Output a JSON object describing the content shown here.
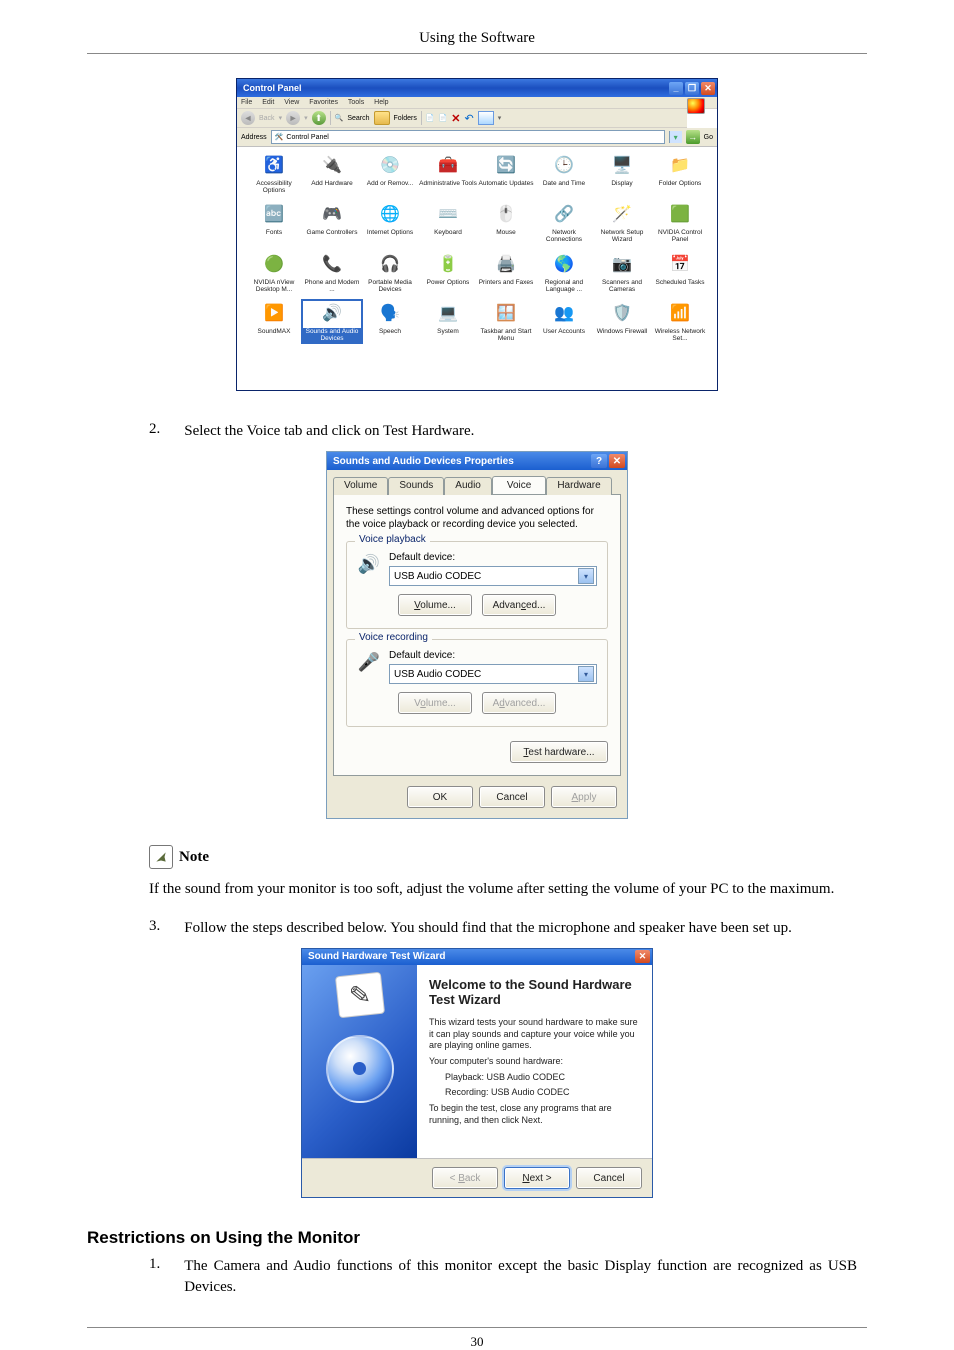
{
  "page_header": "Using the Software",
  "page_number": "30",
  "numbered_items": {
    "2": {
      "num": "2.",
      "text": "Select the Voice tab and click on Test Hardware."
    },
    "3": {
      "num": "3.",
      "text": "Follow the steps described below. You should find that the microphone and speaker have been set up."
    }
  },
  "note": {
    "label": "Note",
    "text": "If the sound from your monitor is too soft, adjust the volume after setting the volume of your PC to the maximum."
  },
  "section_h2": "Restrictions on Using the Monitor",
  "sec_item1": {
    "num": "1.",
    "text": "The Camera and Audio functions of this monitor except the basic Display function are recognized as USB Devices."
  },
  "cp": {
    "title": "Control Panel",
    "menus": {
      "file": "File",
      "edit": "Edit",
      "view": "View",
      "fav": "Favorites",
      "tools": "Tools",
      "help": "Help"
    },
    "toolbar": {
      "back": "Back",
      "search": "Search",
      "folders": "Folders"
    },
    "address": {
      "label": "Address",
      "value": "Control Panel",
      "go": "Go"
    },
    "buttons": {
      "min": "_",
      "max": "❐",
      "close": "✕"
    },
    "items": [
      {
        "label": "Accessibility Options",
        "icon": "♿"
      },
      {
        "label": "Add Hardware",
        "icon": "🔌"
      },
      {
        "label": "Add or Remov...",
        "icon": "💿"
      },
      {
        "label": "Administrative Tools",
        "icon": "🧰"
      },
      {
        "label": "Automatic Updates",
        "icon": "🔄"
      },
      {
        "label": "Date and Time",
        "icon": "🕒"
      },
      {
        "label": "Display",
        "icon": "🖥️"
      },
      {
        "label": "Folder Options",
        "icon": "📁"
      },
      {
        "label": "Fonts",
        "icon": "🔤"
      },
      {
        "label": "Game Controllers",
        "icon": "🎮"
      },
      {
        "label": "Internet Options",
        "icon": "🌐"
      },
      {
        "label": "Keyboard",
        "icon": "⌨️"
      },
      {
        "label": "Mouse",
        "icon": "🖱️"
      },
      {
        "label": "Network Connections",
        "icon": "🔗"
      },
      {
        "label": "Network Setup Wizard",
        "icon": "🪄"
      },
      {
        "label": "NVIDIA Control Panel",
        "icon": "🟩"
      },
      {
        "label": "NVIDIA nView Desktop M...",
        "icon": "🟢"
      },
      {
        "label": "Phone and Modem ...",
        "icon": "📞"
      },
      {
        "label": "Portable Media Devices",
        "icon": "🎧"
      },
      {
        "label": "Power Options",
        "icon": "🔋"
      },
      {
        "label": "Printers and Faxes",
        "icon": "🖨️"
      },
      {
        "label": "Regional and Language ...",
        "icon": "🌎"
      },
      {
        "label": "Scanners and Cameras",
        "icon": "📷"
      },
      {
        "label": "Scheduled Tasks",
        "icon": "📅"
      },
      {
        "label": "SoundMAX",
        "icon": "▶️"
      },
      {
        "label": "Sounds and Audio Devices",
        "icon": "🔊",
        "selected": true
      },
      {
        "label": "Speech",
        "icon": "🗣️"
      },
      {
        "label": "System",
        "icon": "💻"
      },
      {
        "label": "Taskbar and Start Menu",
        "icon": "🪟"
      },
      {
        "label": "User Accounts",
        "icon": "👥"
      },
      {
        "label": "Windows Firewall",
        "icon": "🛡️"
      },
      {
        "label": "Wireless Network Set...",
        "icon": "📶"
      }
    ]
  },
  "sdlg": {
    "title": "Sounds and Audio Devices Properties",
    "buttons": {
      "help": "?",
      "close": "✕"
    },
    "tabs": {
      "volume": "Volume",
      "sounds": "Sounds",
      "audio": "Audio",
      "voice": "Voice",
      "hardware": "Hardware"
    },
    "intro": "These settings control volume and advanced options for the voice playback or recording device you selected.",
    "playback": {
      "legend": "Voice playback",
      "label": "Default device:",
      "device": "USB Audio CODEC"
    },
    "recording": {
      "legend": "Voice recording",
      "label": "Default device:",
      "device": "USB Audio CODEC"
    },
    "btns": {
      "volume": "Volume...",
      "advanced": "Advanced...",
      "volume2": "Volume...",
      "advanced2": "Advanced...",
      "test": "Test hardware..."
    },
    "footer": {
      "ok": "OK",
      "cancel": "Cancel",
      "apply": "Apply"
    }
  },
  "wizard": {
    "title": "Sound Hardware Test Wizard",
    "close": "✕",
    "heading": "Welcome to the Sound Hardware Test Wizard",
    "p1": "This wizard tests your sound hardware to make sure it can play sounds and capture your voice while you are playing online games.",
    "p2": "Your computer's sound hardware:",
    "pb": "Playback:  USB Audio CODEC",
    "rc": "Recording:  USB Audio CODEC",
    "p3": "To begin the test, close any programs that are running, and then click Next.",
    "footer": {
      "back": "< Back",
      "next": "Next >",
      "cancel": "Cancel"
    }
  }
}
